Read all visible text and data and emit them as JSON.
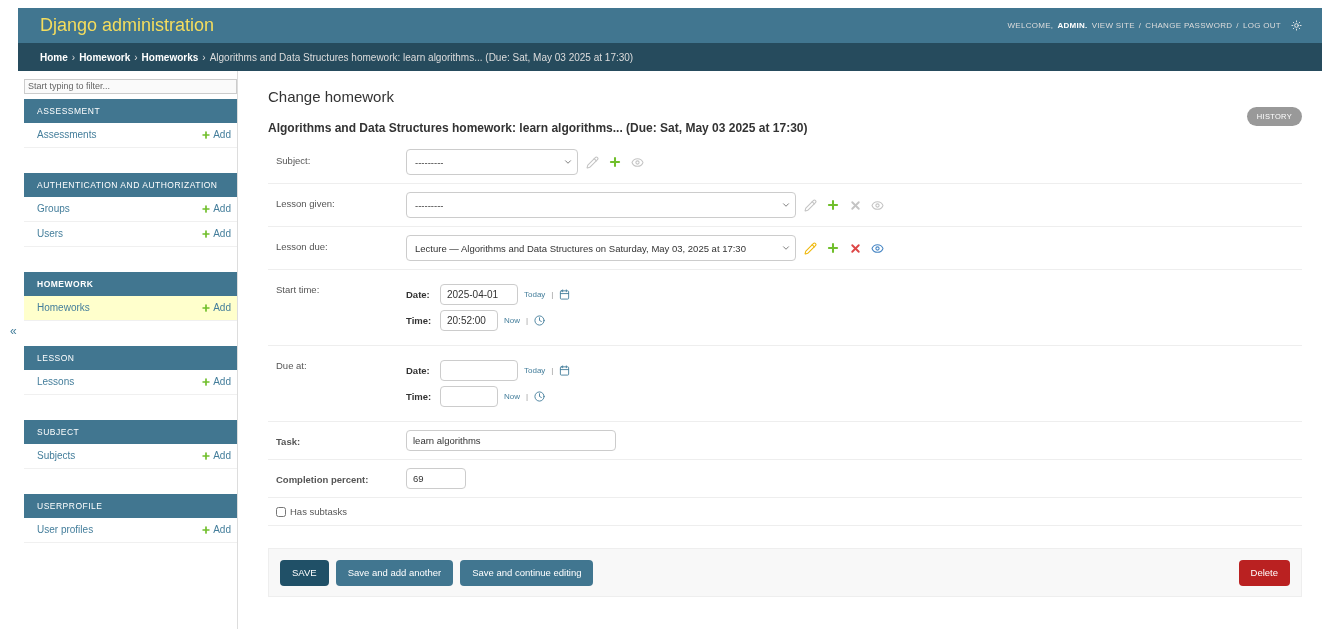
{
  "header": {
    "title": "Django administration",
    "user_tools": [
      {
        "kind": "text",
        "text": "WELCOME,"
      },
      {
        "kind": "strong",
        "text": "ADMIN."
      },
      {
        "kind": "link",
        "text": "VIEW SITE"
      },
      {
        "kind": "sep",
        "text": "/"
      },
      {
        "kind": "link",
        "text": "CHANGE PASSWORD"
      },
      {
        "kind": "sep",
        "text": "/"
      },
      {
        "kind": "link",
        "text": "LOG OUT"
      }
    ]
  },
  "breadcrumbs": {
    "separator": "›",
    "items": [
      "Home",
      "Homework",
      "Homeworks",
      "Algorithms and Data Structures homework: learn algorithms... (Due: Sat, May 03 2025 at 17:30)"
    ]
  },
  "sidebar": {
    "filter_placeholder": "Start typing to filter...",
    "collapse_toggle": "«",
    "modules": [
      {
        "caption": "ASSESSMENT",
        "current": false,
        "models": [
          {
            "name": "Assessments",
            "add": "Add",
            "selected": false
          }
        ]
      },
      {
        "caption": "AUTHENTICATION AND AUTHORIZATION",
        "current": false,
        "models": [
          {
            "name": "Groups",
            "add": "Add",
            "selected": false
          },
          {
            "name": "Users",
            "add": "Add",
            "selected": false
          }
        ]
      },
      {
        "caption": "HOMEWORK",
        "current": true,
        "models": [
          {
            "name": "Homeworks",
            "add": "Add",
            "selected": true
          }
        ]
      },
      {
        "caption": "LESSON",
        "current": false,
        "models": [
          {
            "name": "Lessons",
            "add": "Add",
            "selected": false
          }
        ]
      },
      {
        "caption": "SUBJECT",
        "current": false,
        "models": [
          {
            "name": "Subjects",
            "add": "Add",
            "selected": false
          }
        ]
      },
      {
        "caption": "USERPROFILE",
        "current": false,
        "models": [
          {
            "name": "User profiles",
            "add": "Add",
            "selected": false
          }
        ]
      }
    ]
  },
  "content": {
    "title": "Change homework",
    "object_title": "Algorithms and Data Structures homework: learn algorithms... (Due: Sat, May 03 2025 at 17:30)",
    "history": "HISTORY",
    "fields": [
      {
        "kind": "select",
        "label": "Subject:",
        "required": false,
        "wide": false,
        "value": "---------",
        "actions": [
          {
            "kind": "edit",
            "enabled": false
          },
          {
            "kind": "add",
            "enabled": true
          },
          {
            "kind": "view",
            "enabled": false
          }
        ]
      },
      {
        "kind": "select",
        "label": "Lesson given:",
        "required": false,
        "wide": true,
        "value": "---------",
        "actions": [
          {
            "kind": "edit",
            "enabled": false
          },
          {
            "kind": "add",
            "enabled": true
          },
          {
            "kind": "delete",
            "enabled": false
          },
          {
            "kind": "view",
            "enabled": false
          }
        ]
      },
      {
        "kind": "select",
        "label": "Lesson due:",
        "required": false,
        "wide": true,
        "value": "Lecture — Algorithms and Data Structures on Saturday, May 03, 2025 at 17:30",
        "actions": [
          {
            "kind": "edit",
            "enabled": true
          },
          {
            "kind": "add",
            "enabled": true
          },
          {
            "kind": "delete",
            "enabled": true
          },
          {
            "kind": "view",
            "enabled": true
          }
        ]
      },
      {
        "kind": "datetime",
        "label": "Start time:",
        "required": false,
        "parts": [
          {
            "kind": "date",
            "label": "Date:",
            "value": "2025-04-01",
            "shortcut": "Today",
            "separator": "|"
          },
          {
            "kind": "time",
            "label": "Time:",
            "value": "20:52:00",
            "shortcut": "Now",
            "separator": "|"
          }
        ]
      },
      {
        "kind": "datetime",
        "label": "Due at:",
        "required": false,
        "parts": [
          {
            "kind": "date",
            "label": "Date:",
            "shortcut": "Today",
            "separator": "|"
          },
          {
            "kind": "time",
            "label": "Time:",
            "shortcut": "Now",
            "separator": "|"
          }
        ]
      },
      {
        "kind": "text",
        "label": "Task:",
        "required": true,
        "value": "learn algorithms"
      },
      {
        "kind": "number",
        "label": "Completion percent:",
        "required": true,
        "value": "69"
      },
      {
        "kind": "checkbox",
        "label": "Has subtasks",
        "required": false,
        "checked": false
      }
    ],
    "buttons": [
      {
        "kind": "default",
        "label": "SAVE"
      },
      {
        "kind": "secondary",
        "label": "Save and add another"
      },
      {
        "kind": "secondary",
        "label": "Save and continue editing"
      },
      {
        "kind": "delete",
        "label": "Delete"
      }
    ]
  }
}
